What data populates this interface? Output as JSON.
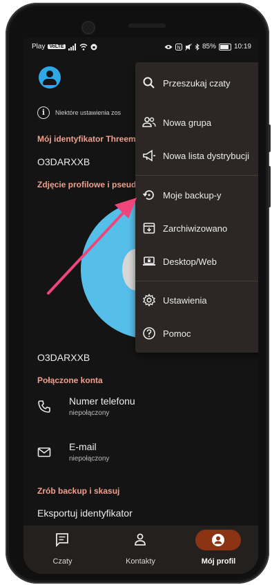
{
  "status_bar": {
    "operator": "Play",
    "network_tag": "VoLTE",
    "battery": "85%",
    "time": "10:19",
    "battery_level": 0.85
  },
  "screen": {
    "notice": "Niektóre ustawienia zos",
    "threema_id_title": "Mój identyfikator Threema",
    "threema_id_value": "O3DARXXB",
    "photo_title": "Zdjęcie profilowe i pseudonim",
    "nickname_value": "O3DARXXB",
    "linked_accounts_title": "Połączone konta",
    "phone_label": "Numer telefonu",
    "phone_status": "niepołączony",
    "email_label": "E-mail",
    "email_status": "niepołączony",
    "backup_title": "Zrób backup i skasuj",
    "export_label": "Eksportuj identyfikator"
  },
  "menu": {
    "items": [
      {
        "label": "Przeszukaj czaty",
        "icon": "search-icon"
      },
      {
        "label": "Nowa grupa",
        "icon": "group-icon"
      },
      {
        "label": "Nowa lista dystrybucji",
        "icon": "megaphone-icon"
      },
      {
        "label": "Moje backup-y",
        "icon": "backup-restore-icon"
      },
      {
        "label": "Zarchiwizowano",
        "icon": "archive-icon"
      },
      {
        "label": "Desktop/Web",
        "icon": "laptop-lock-icon"
      },
      {
        "label": "Ustawienia",
        "icon": "gear-icon"
      },
      {
        "label": "Pomoc",
        "icon": "help-icon"
      }
    ]
  },
  "nav": {
    "items": [
      {
        "label": "Czaty",
        "icon": "chat-icon"
      },
      {
        "label": "Kontakty",
        "icon": "contacts-icon"
      },
      {
        "label": "Mój profil",
        "icon": "profile-icon"
      }
    ],
    "active": "Mój profil"
  },
  "colors": {
    "accent": "#f0a08c",
    "annotation_arrow": "#f0457a",
    "active_tab": "#8a3414",
    "avatar": "#55bfea"
  }
}
